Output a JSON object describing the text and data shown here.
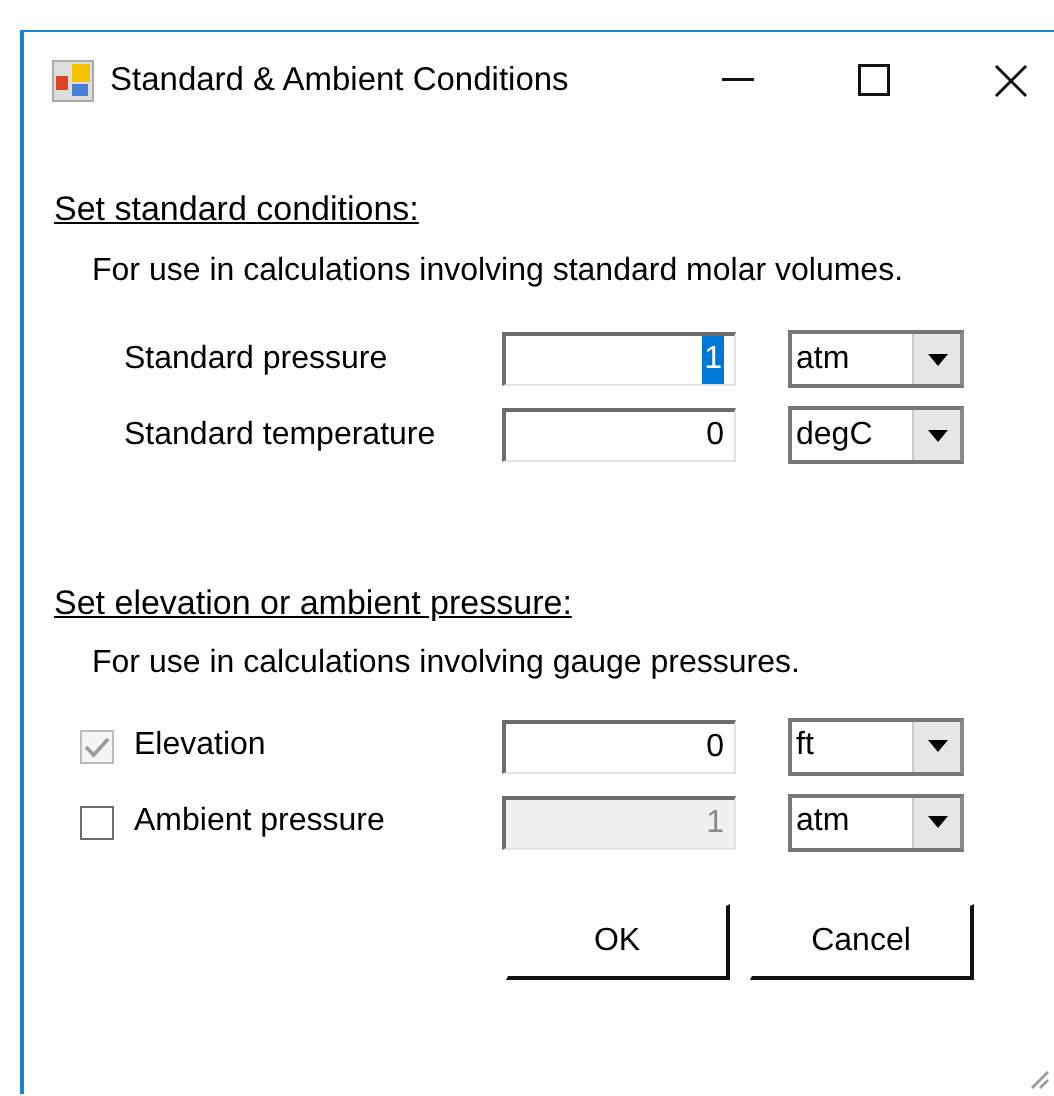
{
  "window": {
    "title": "Standard & Ambient Conditions"
  },
  "sections": [
    {
      "heading": "Set standard conditions:",
      "description": "For use in calculations involving standard molar volumes.",
      "rows": [
        {
          "kind": "label",
          "label": "Standard pressure",
          "value": "1",
          "text_selected": true,
          "disabled": false,
          "unit": "atm"
        },
        {
          "kind": "label",
          "label": "Standard temperature",
          "value": "0",
          "text_selected": false,
          "disabled": false,
          "unit": "degC"
        }
      ]
    },
    {
      "heading": "Set elevation or ambient pressure:",
      "description": "For use in calculations involving gauge pressures.",
      "rows": [
        {
          "kind": "checkbox",
          "label": "Elevation",
          "checked": true,
          "check_disabled": true,
          "value": "0",
          "text_selected": false,
          "disabled": false,
          "unit": "ft"
        },
        {
          "kind": "checkbox",
          "label": "Ambient pressure",
          "checked": false,
          "check_disabled": false,
          "value": "1",
          "text_selected": false,
          "disabled": true,
          "unit": "atm"
        }
      ]
    }
  ],
  "buttons": [
    "OK",
    "Cancel"
  ]
}
